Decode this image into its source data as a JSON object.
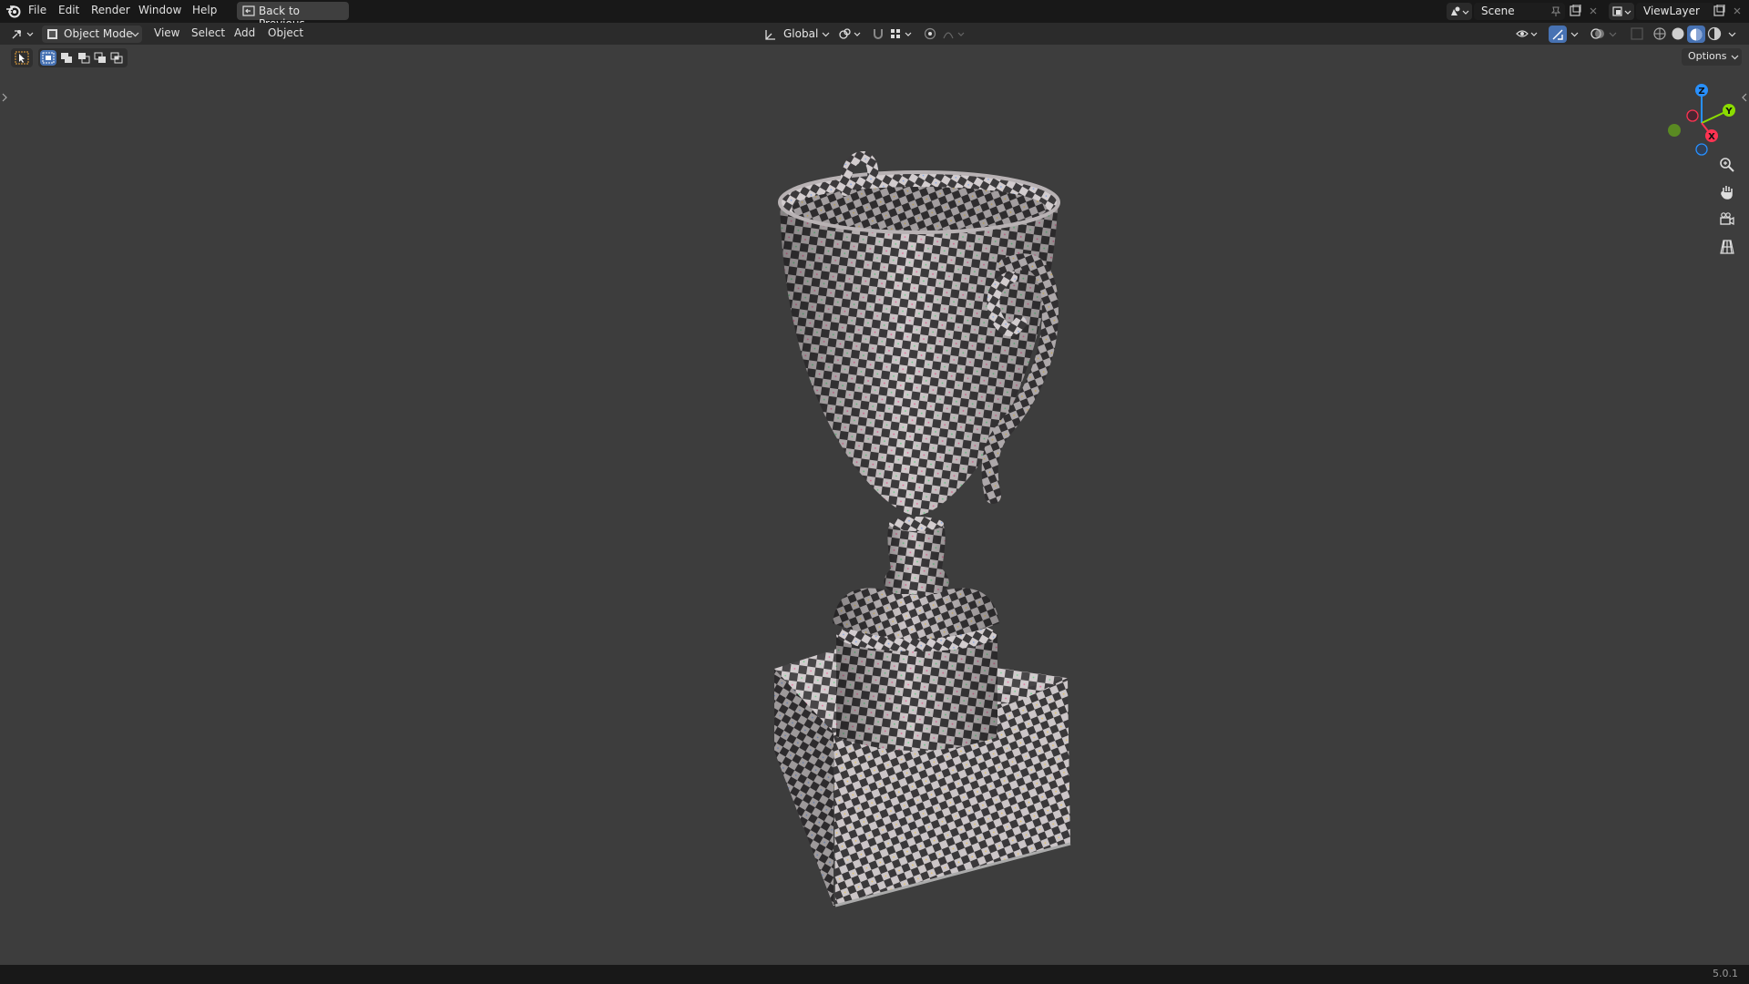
{
  "topbar": {
    "menu": [
      "File",
      "Edit",
      "Render",
      "Window",
      "Help"
    ],
    "back_label": "Back to Previous",
    "scene_name": "Scene",
    "view_layer": "ViewLayer"
  },
  "header": {
    "mode": "Object Mode",
    "menus": [
      "View",
      "Select",
      "Add",
      "Object"
    ],
    "transform_orientation": "Global",
    "options_label": "Options"
  },
  "viewport": {
    "object": "trophy with checker texture",
    "gizmo_axes": [
      "Z",
      "Y",
      "X"
    ]
  },
  "status": {
    "version": "5.0.1"
  },
  "colors": {
    "accent_blue": "#4772b3",
    "axis_x": "#ff3352",
    "axis_y": "#8bdc00",
    "axis_z": "#2890ff"
  }
}
